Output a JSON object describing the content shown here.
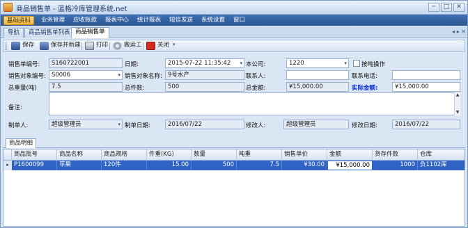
{
  "window": {
    "title": "商品销售单 - 蓝格冷库管理系统.net",
    "buttons": [
      "─",
      "□",
      "✕"
    ]
  },
  "menu": {
    "items": [
      "基础资料",
      "业务管理",
      "应收账款",
      "报表中心",
      "统计报表",
      "短信发送",
      "系统设置",
      "窗口"
    ],
    "active_index": 0
  },
  "tabs": {
    "items": [
      "导航",
      "商品销售单列表",
      "商品销售单"
    ],
    "active_index": 2,
    "nav_glyph": "◂ ▸ ✕"
  },
  "toolbar": {
    "save": "保存",
    "save_new": "保存并新建",
    "print": "打印",
    "porter": "搬运工",
    "close": "关闭",
    "dropdown_glyph": "▾",
    "icons": {
      "save": "save-icon",
      "save_new": "save-new-icon",
      "print": "printer-icon",
      "porter": "gear-icon",
      "close": "close-icon"
    }
  },
  "form": {
    "order_no_label": "销售单编号:",
    "order_no": "S160722001",
    "date_label": "日期:",
    "date": "2015-07-22  11:35:42",
    "company_label": "本公司:",
    "company": "1220",
    "by_ton_label": "按吨操作",
    "by_ton_checked": false,
    "customer_code_label": "销售对象编号:",
    "customer_code": "S0006",
    "customer_name_label": "销售对象名称:",
    "customer_name": "9号水产",
    "contact_label": "联系人:",
    "contact": "",
    "phone_label": "联系电话:",
    "phone": "",
    "total_weight_label": "总重量(吨)",
    "total_weight": "7.5",
    "total_qty_label": "总件数:",
    "total_qty": "500",
    "total_amount_label": "总金额:",
    "total_amount": "¥15,000.00",
    "actual_amount_label": "实际金额:",
    "actual_amount": "¥15,000.00",
    "remark_label": "备注:",
    "remark": "",
    "creator_label": "制单人:",
    "creator": "超级管理员",
    "create_date_label": "制单日期:",
    "create_date": "2016/07/22",
    "modifier_label": "修改人:",
    "modifier": "超级管理员",
    "modify_date_label": "修改日期:",
    "modify_date": "2016/07/22",
    "dropdown_glyph": "▾"
  },
  "detail": {
    "tab_label": "商品明细",
    "columns": [
      "商品批号",
      "商品名称",
      "商品规格",
      "件重(KG)",
      "数量",
      "吨重",
      "销售单价",
      "金额",
      "货存件数",
      "仓库"
    ],
    "rows": [
      {
        "indicator": "▸",
        "batch": "P1600099",
        "name": "苹果",
        "spec": "120件",
        "piece_weight": "15.00",
        "quantity": "500",
        "ton_weight": "7.5",
        "unit_price": "¥30.00",
        "amount": "¥15,000.00",
        "stock_qty": "1000",
        "warehouse": "负1102库"
      }
    ]
  },
  "colors": {
    "menubar": "#2b568f",
    "active_menu": "#f4b43c",
    "selected_row": "#2f63c6",
    "actual_amount_label": "#0a2fd6"
  }
}
